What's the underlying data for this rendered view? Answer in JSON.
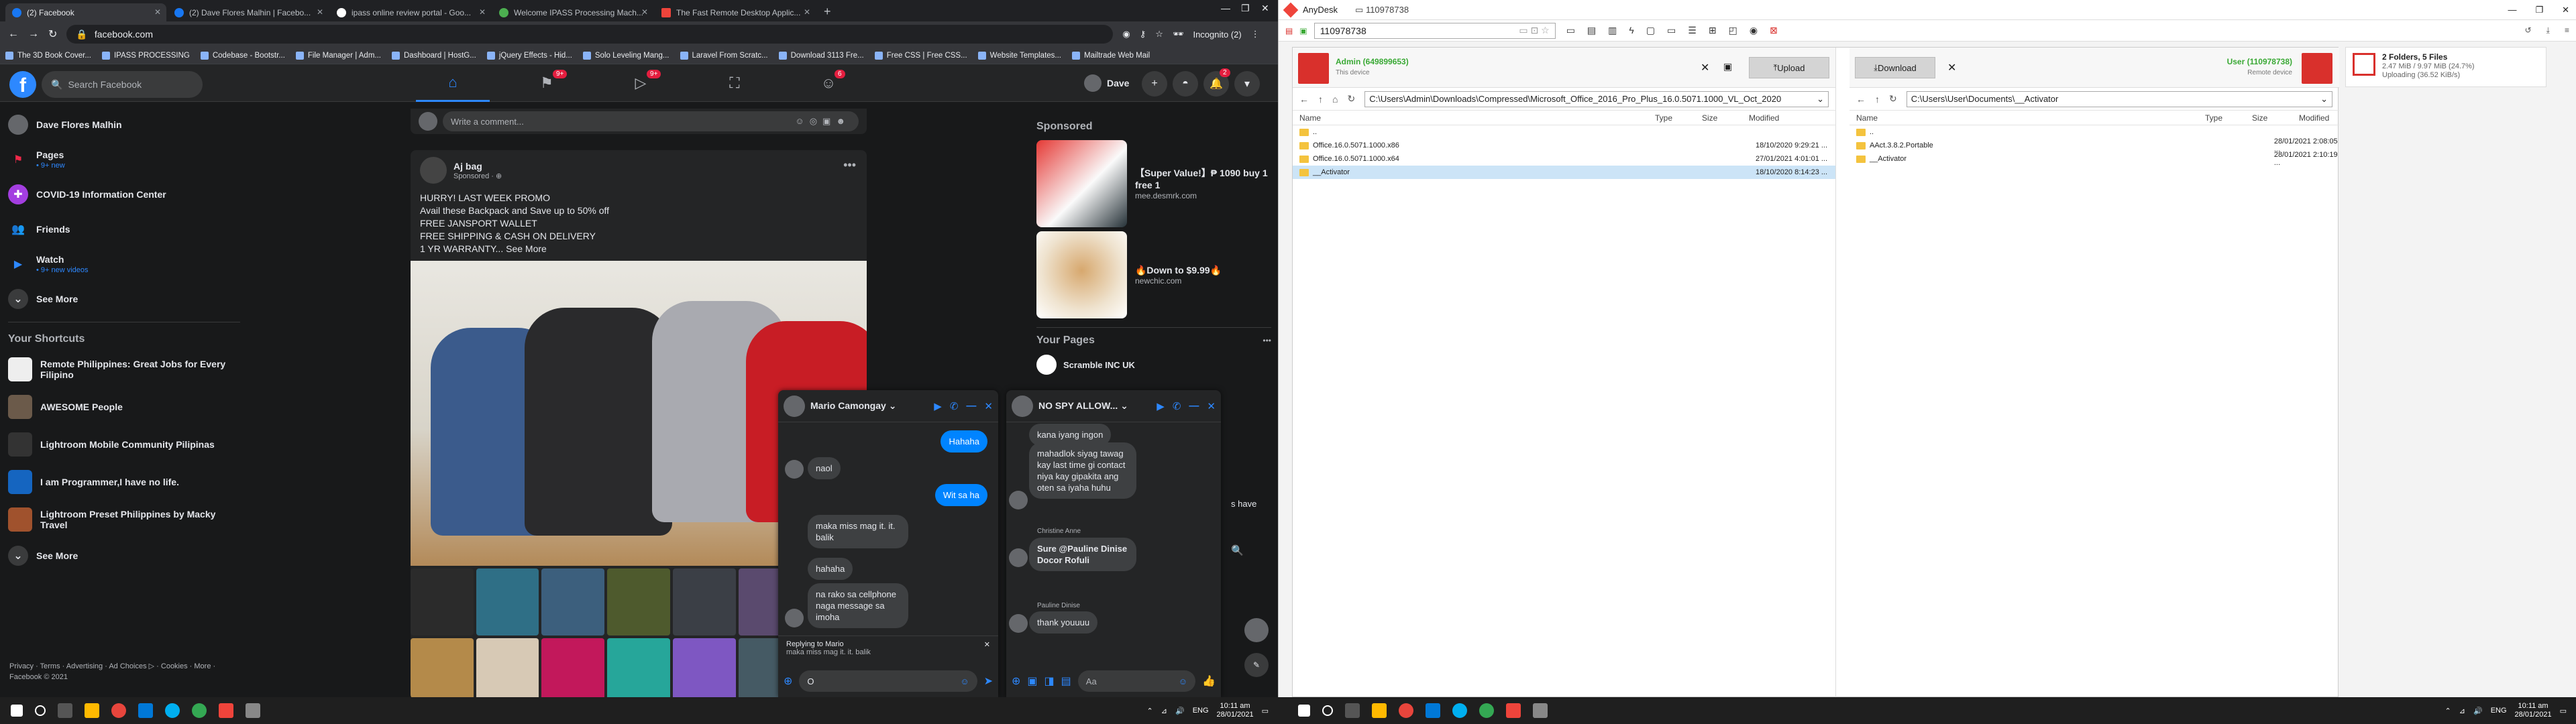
{
  "chrome": {
    "tabs": [
      {
        "title": "(2) Facebook",
        "active": true
      },
      {
        "title": "(2) Dave Flores Malhin | Facebo..."
      },
      {
        "title": "ipass online review portal - Goo..."
      },
      {
        "title": "Welcome IPASS Processing Mach..."
      },
      {
        "title": "The Fast Remote Desktop Applic..."
      }
    ],
    "url": "facebook.com",
    "profile_label": "Incognito (2)",
    "bookmarks": [
      "The 3D Book Cover...",
      "IPASS PROCESSING",
      "Codebase - Bootstr...",
      "File Manager | Adm...",
      "Dashboard | HostG...",
      "jQuery Effects - Hid...",
      "Solo Leveling Mang...",
      "Laravel From Scratc...",
      "Download 3113 Fre...",
      "Free CSS | Free CSS...",
      "Website Templates...",
      "Mailtrade Web Mail"
    ]
  },
  "fb": {
    "search_placeholder": "Search Facebook",
    "nav_badges": {
      "pages": "9+",
      "watch": "9+",
      "groups": "6"
    },
    "user_first": "Dave",
    "notif_badge": "2",
    "sidebar": [
      {
        "label": "Dave Flores Malhin",
        "sub": ""
      },
      {
        "label": "Pages",
        "sub": "• 9+ new"
      },
      {
        "label": "COVID-19 Information Center",
        "sub": ""
      },
      {
        "label": "Friends",
        "sub": ""
      },
      {
        "label": "Watch",
        "sub": "• 9+ new videos"
      },
      {
        "label": "See More",
        "sub": ""
      }
    ],
    "shortcuts_header": "Your Shortcuts",
    "shortcuts": [
      "Remote Philippines: Great Jobs for Every Filipino",
      "AWESOME People",
      "Lightroom Mobile Community Pilipinas",
      "I am Programmer,I have no life.",
      "Lightroom Preset Philippines by Macky Travel",
      "See More"
    ],
    "footer": "Privacy · Terms · Advertising · Ad Choices ▷ · Cookies · More · Facebook © 2021",
    "comment_placeholder": "Write a comment...",
    "post": {
      "author": "Aj bag",
      "meta": "Sponsored · ⊕",
      "lines": [
        "HURRY! LAST WEEK PROMO",
        "Avail these Backpack and Save up to 50% off",
        "FREE JANSPORT WALLET",
        "FREE SHIPPING & CASH ON DELIVERY",
        "1 YR WARRANTY... See More"
      ]
    },
    "sponsored_header": "Sponsored",
    "ads": [
      {
        "title": "【Super Value!】₱ 1090 buy 1 free 1",
        "domain": "mee.desmrk.com"
      },
      {
        "title": "🔥Down to $9.99🔥",
        "domain": "newchic.com"
      }
    ],
    "your_pages": "Your Pages",
    "page_name": "Scramble INC UK",
    "partial_text": "s have",
    "chat1": {
      "name": "Mario Camongay ⌄",
      "messages": [
        "Hahaha",
        "naol",
        "Wit sa ha",
        "maka miss mag it. it. balik",
        "hahaha",
        "na rako sa cellphone naga message sa imoha"
      ],
      "reply_to": "Replying to Mario",
      "reply_quote": "maka miss mag it. it. balik",
      "input": "O"
    },
    "chat2": {
      "name": "NO SPY ALLOW... ⌄",
      "messages": [
        "kana iyang ingon",
        "mahadlok siyag tawag kay last time gi contact niya kay gipakita ang oten sa iyaha huhu",
        "Sure @Pauline Dinise Docor Rofuli",
        "thank youuuu"
      ],
      "senders": [
        "Christine Anne",
        "Pauline Dinise"
      ],
      "input_placeholder": "Aa"
    }
  },
  "anydesk": {
    "title": "AnyDesk",
    "session": "110978738",
    "address": "110978738",
    "local": {
      "name": "Admin (649899653)",
      "sub": "This device",
      "path": "C:\\Users\\Admin\\Downloads\\Compressed\\Microsoft_Office_2016_Pro_Plus_16.0.5071.1000_VL_Oct_2020",
      "button": "Upload"
    },
    "remote": {
      "name": "User (110978738)",
      "sub": "Remote device",
      "path": "C:\\Users\\User\\Documents\\__Activator",
      "button": "Download"
    },
    "columns": {
      "name": "Name",
      "type": "Type",
      "size": "Size",
      "modified": "Modified"
    },
    "local_files": [
      {
        "name": "..",
        "modified": ""
      },
      {
        "name": "Office.16.0.5071.1000.x86",
        "modified": "18/10/2020 9:29:21 ..."
      },
      {
        "name": "Office.16.0.5071.1000.x64",
        "modified": "27/01/2021 4:01:01 ..."
      },
      {
        "name": "__Activator",
        "modified": "18/10/2020 8:14:23 ..."
      }
    ],
    "remote_files": [
      {
        "name": "..",
        "modified": ""
      },
      {
        "name": "AAct.3.8.2.Portable",
        "modified": "28/01/2021 2:08:05 ..."
      },
      {
        "name": "__Activator",
        "modified": "28/01/2021 2:10:19 ..."
      }
    ],
    "transfer": {
      "title": "2 Folders, 5 Files",
      "detail": "2.47 MiB / 9.97 MiB (24.7%)",
      "speed": "Uploading (36.52 KiB/s)"
    }
  },
  "taskbar": {
    "lang": "ENG",
    "time": "10:11 am",
    "date": "28/01/2021"
  },
  "colors": {
    "fb_blue": "#2d88ff",
    "messenger": "#0084ff",
    "anydesk_red": "#d9302c",
    "online_green": "#3aa935"
  }
}
